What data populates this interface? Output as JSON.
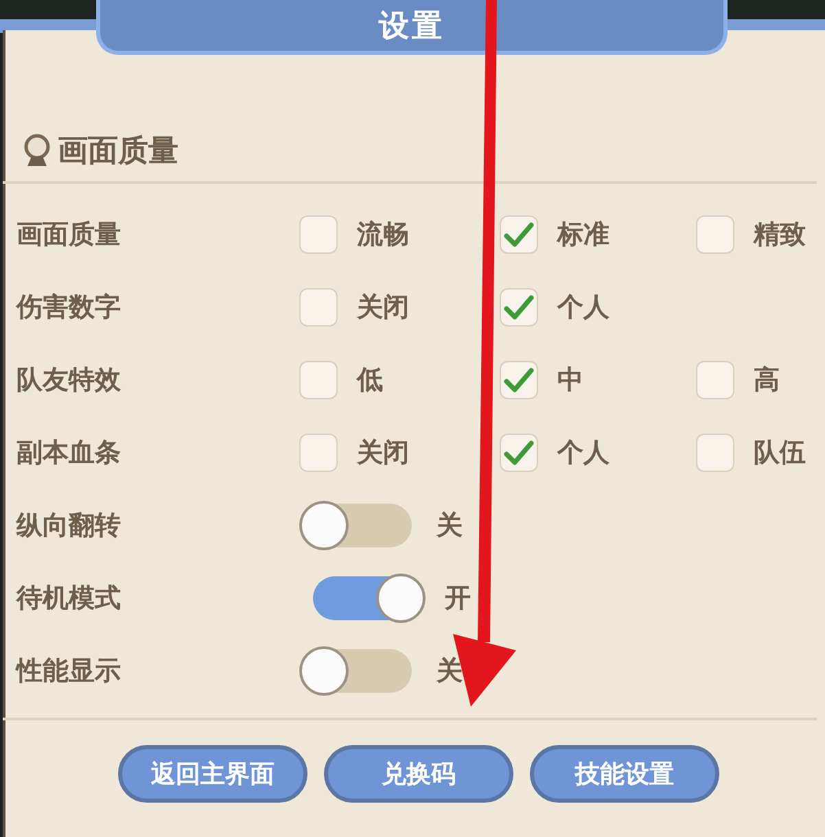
{
  "window": {
    "title": "设置"
  },
  "section": {
    "title": "画面质量"
  },
  "rows": [
    {
      "kind": "choice",
      "label": "画面质量",
      "options": [
        {
          "label": "流畅",
          "checked": false
        },
        {
          "label": "标准",
          "checked": true
        },
        {
          "label": "精致",
          "checked": false
        }
      ]
    },
    {
      "kind": "choice",
      "label": "伤害数字",
      "options": [
        {
          "label": "关闭",
          "checked": false
        },
        {
          "label": "个人",
          "checked": true
        }
      ]
    },
    {
      "kind": "choice",
      "label": "队友特效",
      "options": [
        {
          "label": "低",
          "checked": false
        },
        {
          "label": "中",
          "checked": true
        },
        {
          "label": "高",
          "checked": false
        }
      ]
    },
    {
      "kind": "choice",
      "label": "副本血条",
      "options": [
        {
          "label": "关闭",
          "checked": false
        },
        {
          "label": "个人",
          "checked": true
        },
        {
          "label": "队伍",
          "checked": false
        }
      ]
    },
    {
      "kind": "toggle",
      "label": "纵向翻转",
      "on": false,
      "state": "关"
    },
    {
      "kind": "toggle",
      "label": "待机模式",
      "on": true,
      "state": "开"
    },
    {
      "kind": "toggle",
      "label": "性能显示",
      "on": false,
      "state": "关"
    }
  ],
  "buttons": [
    "返回主界面",
    "兑换码",
    "技能设置"
  ]
}
